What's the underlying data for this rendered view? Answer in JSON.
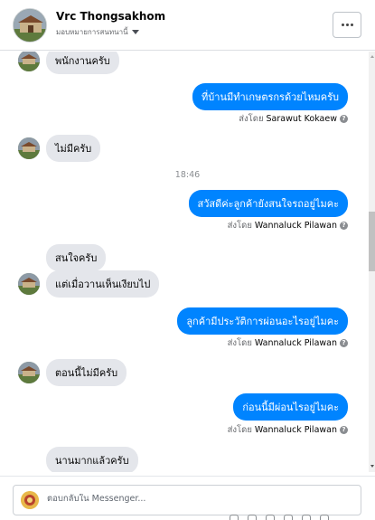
{
  "header": {
    "name": "Vrc Thongsakhom",
    "subtitle": "มอบหมายการสนทนานี้",
    "more_label": "..."
  },
  "messages": [
    {
      "type": "in",
      "text": "พนักงานครับ"
    },
    {
      "type": "out",
      "text": "ที่บ้านมีทำเกษตรกรด้วยไหมครับ",
      "sent_by_label": "ส่งโดย",
      "sent_by_name": "Sarawut Kokaew"
    },
    {
      "type": "in",
      "text": "ไม่มีครับ"
    },
    {
      "type": "time",
      "text": "18:46"
    },
    {
      "type": "out",
      "text": "สวัสดีค่ะลูกค้ายังสนใจรถอยู่ไมคะ",
      "sent_by_label": "ส่งโดย",
      "sent_by_name": "Wannaluck Pilawan"
    },
    {
      "type": "in",
      "text": "สนใจครับ"
    },
    {
      "type": "in",
      "text": "แต่เมื่อวานเห็นเงียบไป"
    },
    {
      "type": "out",
      "text": "ลูกค้ามีประวัติการผ่อนอะไรอยู่ไมคะ",
      "sent_by_label": "ส่งโดย",
      "sent_by_name": "Wannaluck Pilawan"
    },
    {
      "type": "in",
      "text": "ตอนนี้ไม่มีครับ"
    },
    {
      "type": "out",
      "text": "ก่อนนี้มีผ่อนไรอยู่ไมคะ",
      "sent_by_label": "ส่งโดย",
      "sent_by_name": "Wannaluck Pilawan"
    },
    {
      "type": "in",
      "text": "นานมากแล้วครับ"
    }
  ],
  "composer": {
    "placeholder": "ตอบกลับใน Messenger..."
  },
  "icons": {
    "more": "more-horizontal-icon",
    "help": "question-circle-icon",
    "caret": "caret-down-icon"
  },
  "colors": {
    "outgoing_bubble": "#0084ff",
    "incoming_bubble": "#e4e6eb"
  }
}
